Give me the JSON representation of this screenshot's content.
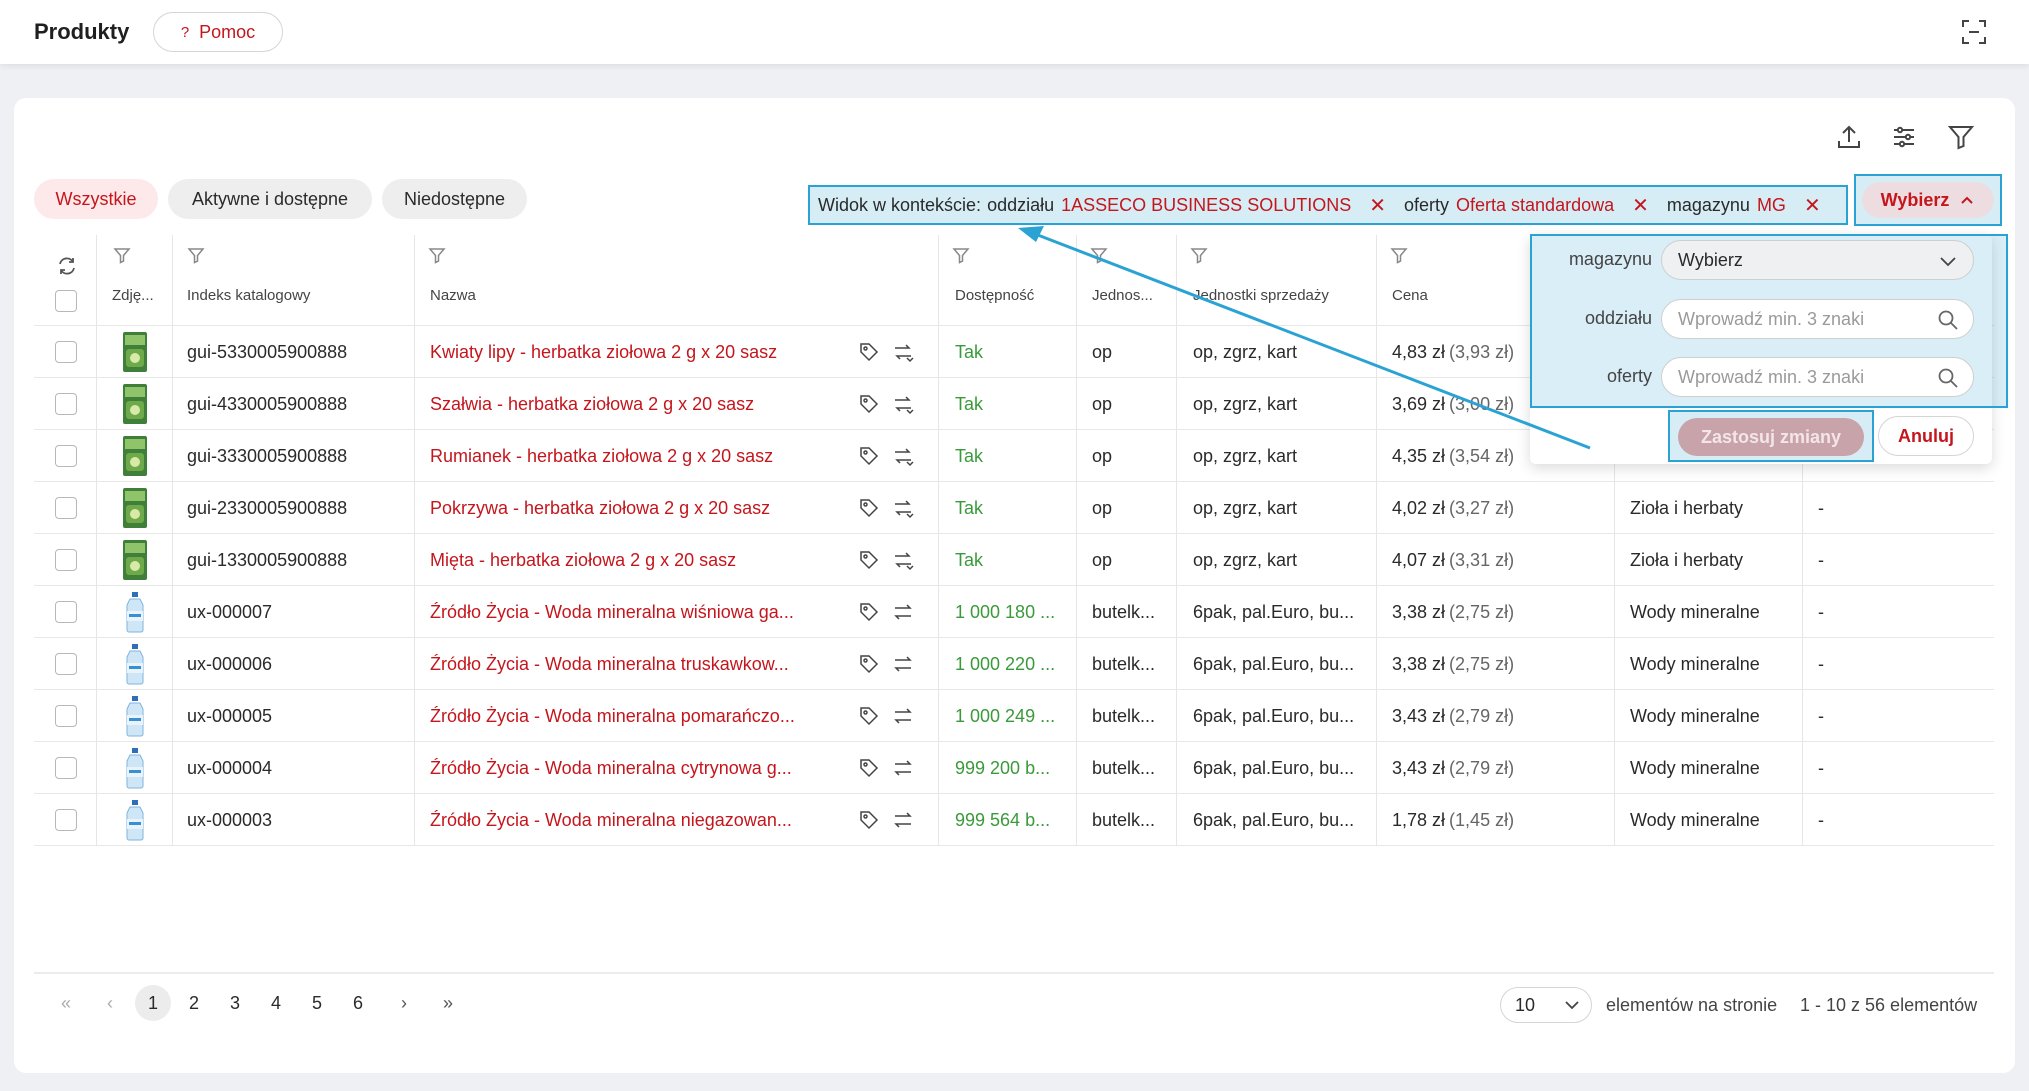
{
  "header": {
    "title": "Produkty",
    "help_label": "Pomoc",
    "help_glyph": "?"
  },
  "segments": [
    {
      "label": "Wszystkie",
      "active": true
    },
    {
      "label": "Aktywne i dostępne",
      "active": false
    },
    {
      "label": "Niedostępne",
      "active": false
    }
  ],
  "context": {
    "prefix": "Widok w kontekście:",
    "branch_label": "oddziału",
    "branch_value": "1ASSECO BUSINESS SOLUTIONS",
    "offer_label": "oferty",
    "offer_value": "Oferta standardowa",
    "warehouse_label": "magazynu",
    "warehouse_value": "MG",
    "choose_label": "Wybierz"
  },
  "columns": [
    "Zdję...",
    "Indeks katalogowy",
    "Nazwa",
    "Dostępność",
    "Jednos...",
    "Jednostki sprzedaży",
    "Cena"
  ],
  "rows": [
    {
      "img": "tea",
      "index": "gui-5330005900888",
      "name": "Kwiaty lipy - herbatka ziołowa 2 g x 20 sasz",
      "avail": "Tak",
      "unit": "op",
      "units": "op, zgrz, kart",
      "price": "4,83 zł",
      "net": "(3,93 zł)",
      "category": "",
      "extra": ""
    },
    {
      "img": "tea",
      "index": "gui-4330005900888",
      "name": "Szałwia - herbatka ziołowa 2 g x 20 sasz",
      "avail": "Tak",
      "unit": "op",
      "units": "op, zgrz, kart",
      "price": "3,69 zł",
      "net": "(3,00 zł)",
      "category": "",
      "extra": ""
    },
    {
      "img": "tea",
      "index": "gui-3330005900888",
      "name": "Rumianek - herbatka ziołowa 2 g x 20 sasz",
      "avail": "Tak",
      "unit": "op",
      "units": "op, zgrz, kart",
      "price": "4,35 zł",
      "net": "(3,54 zł)",
      "category": "",
      "extra": ""
    },
    {
      "img": "tea",
      "index": "gui-2330005900888",
      "name": "Pokrzywa - herbatka ziołowa 2 g x 20 sasz",
      "avail": "Tak",
      "unit": "op",
      "units": "op, zgrz, kart",
      "price": "4,02 zł",
      "net": "(3,27 zł)",
      "category": "Zioła i herbaty",
      "extra": "-"
    },
    {
      "img": "tea",
      "index": "gui-1330005900888",
      "name": "Mięta - herbatka ziołowa 2 g x 20 sasz",
      "avail": "Tak",
      "unit": "op",
      "units": "op, zgrz, kart",
      "price": "4,07 zł",
      "net": "(3,31 zł)",
      "category": "Zioła i herbaty",
      "extra": "-"
    },
    {
      "img": "water",
      "index": "ux-000007",
      "name": "Źródło Życia - Woda mineralna wiśniowa ga...",
      "avail": "1 000 180 ...",
      "unit": "butelk...",
      "units": "6pak, pal.Euro, bu...",
      "price": "3,38 zł",
      "net": "(2,75 zł)",
      "category": "Wody mineralne",
      "extra": "-"
    },
    {
      "img": "water",
      "index": "ux-000006",
      "name": "Źródło Życia - Woda mineralna truskawkow...",
      "avail": "1 000 220 ...",
      "unit": "butelk...",
      "units": "6pak, pal.Euro, bu...",
      "price": "3,38 zł",
      "net": "(2,75 zł)",
      "category": "Wody mineralne",
      "extra": "-"
    },
    {
      "img": "water",
      "index": "ux-000005",
      "name": "Źródło Życia - Woda mineralna pomarańczo...",
      "avail": "1 000 249 ...",
      "unit": "butelk...",
      "units": "6pak, pal.Euro, bu...",
      "price": "3,43 zł",
      "net": "(2,79 zł)",
      "category": "Wody mineralne",
      "extra": "-"
    },
    {
      "img": "water",
      "index": "ux-000004",
      "name": "Źródło Życia - Woda mineralna cytrynowa g...",
      "avail": "999 200 b...",
      "unit": "butelk...",
      "units": "6pak, pal.Euro, bu...",
      "price": "3,43 zł",
      "net": "(2,79 zł)",
      "category": "Wody mineralne",
      "extra": "-"
    },
    {
      "img": "water",
      "index": "ux-000003",
      "name": "Źródło Życia - Woda mineralna niegazowan...",
      "avail": "999 564 b...",
      "unit": "butelk...",
      "units": "6pak, pal.Euro, bu...",
      "price": "1,78 zł",
      "net": "(1,45 zł)",
      "category": "Wody mineralne",
      "extra": "-"
    }
  ],
  "dropdown": {
    "warehouse_label": "magazynu",
    "warehouse_value": "Wybierz",
    "branch_label": "oddziału",
    "branch_placeholder": "Wprowadź min. 3 znaki",
    "offer_label": "oferty",
    "offer_placeholder": "Wprowadź min. 3 znaki",
    "apply_label": "Zastosuj zmiany",
    "cancel_label": "Anuluj"
  },
  "pagination": {
    "pages": [
      "1",
      "2",
      "3",
      "4",
      "5",
      "6"
    ],
    "current": "1",
    "page_size": "10",
    "per_page_label": "elementów na stronie",
    "range_label": "1 - 10 z 56 elementów"
  },
  "colors": {
    "accent": "#c4161c",
    "highlight": "#2aa3d4",
    "green": "#3a9a3a"
  }
}
